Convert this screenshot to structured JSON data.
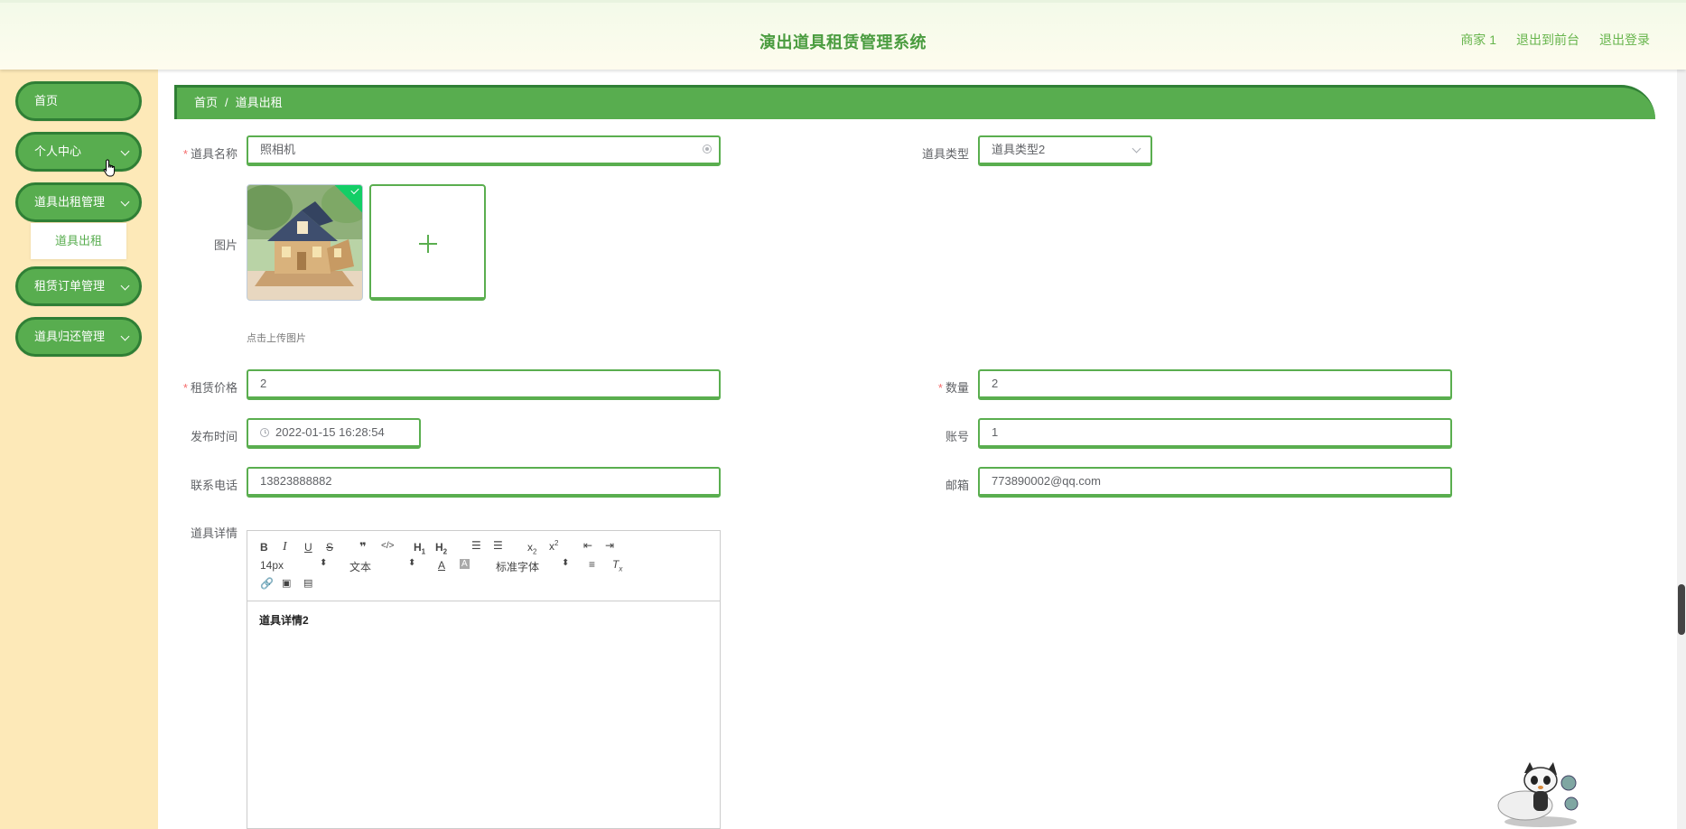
{
  "header": {
    "title": "演出道具租赁管理系统",
    "user": "商家 1",
    "front_link": "退出到前台",
    "logout_link": "退出登录"
  },
  "sidebar": {
    "items": [
      {
        "label": "首页",
        "expandable": false
      },
      {
        "label": "个人中心",
        "expandable": true
      },
      {
        "label": "道具出租管理",
        "expandable": true
      },
      {
        "label": "租赁订单管理",
        "expandable": true
      },
      {
        "label": "道具归还管理",
        "expandable": true
      }
    ],
    "sub_item": "道具出租"
  },
  "breadcrumb": {
    "home": "首页",
    "separator": "/",
    "current": "道具出租"
  },
  "form": {
    "name_label": "道具名称",
    "name_value": "照相机",
    "type_label": "道具类型",
    "type_value": "道具类型2",
    "image_label": "图片",
    "upload_hint": "点击上传图片",
    "price_label": "租赁价格",
    "price_value": "2",
    "quantity_label": "数量",
    "quantity_value": "2",
    "publish_label": "发布时间",
    "publish_value": "2022-01-15 16:28:54",
    "account_label": "账号",
    "account_value": "1",
    "phone_label": "联系电话",
    "phone_value": "13823888882",
    "email_label": "邮箱",
    "email_value": "773890002@qq.com",
    "detail_label": "道具详情"
  },
  "editor": {
    "font_size": "14px",
    "text_style": "文本",
    "font_family": "标准字体",
    "content": "道具详情2",
    "toolbar_icons": [
      "bold-icon",
      "italic-icon",
      "underline-icon",
      "strike-icon",
      "quote-icon",
      "code-icon",
      "h1-icon",
      "h2-icon",
      "ordered-list-icon",
      "bullet-list-icon",
      "subscript-icon",
      "superscript-icon",
      "outdent-icon",
      "indent-icon",
      "font-color-icon",
      "background-color-icon",
      "align-icon",
      "clear-format-icon",
      "link-icon",
      "image-icon",
      "video-icon"
    ]
  },
  "colors": {
    "accent": "#58ad4f",
    "accent_dark": "#2f7f35",
    "sidebar_bg": "#fde9b8",
    "header_title": "#4a9c3f",
    "required": "#f56c6c"
  }
}
